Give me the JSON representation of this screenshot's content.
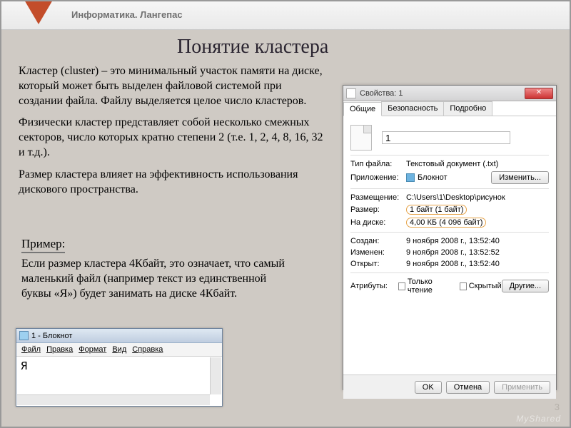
{
  "topbar": {
    "title": "Информатика. Лангепас"
  },
  "slide": {
    "title": "Понятие кластера",
    "p1": "Кластер (cluster) – это минимальный участок памяти на диске, который может быть выделен файловой системой при создании файла. Файлу выделяется целое число кластеров.",
    "p2": "Физически кластер представляет собой несколько смежных секторов, число которых кратно степени 2 (т.е. 1, 2, 4, 8, 16, 32 и т.д.).",
    "p3": "Размер кластера влияет на эффективность использования дискового пространства.",
    "example_label": "Пример:",
    "example_text": "Если размер кластера 4Кбайт, это означает, что самый маленький файл (например текст из единственной буквы «Я») будет занимать на диске 4Кбайт.",
    "number": "3"
  },
  "propwin": {
    "title": "Свойства: 1",
    "tabs": {
      "general": "Общие",
      "security": "Безопасность",
      "details": "Подробно"
    },
    "filename": "1",
    "rows": {
      "type_label": "Тип файла:",
      "type_value": "Текстовый документ (.txt)",
      "app_label": "Приложение:",
      "app_value": "Блокнот",
      "change_btn": "Изменить...",
      "location_label": "Размещение:",
      "location_value": "C:\\Users\\1\\Desktop\\рисунок",
      "size_label": "Размер:",
      "size_value": "1 байт (1 байт)",
      "ondisk_label": "На диске:",
      "ondisk_value": "4,00 КБ (4 096 байт)",
      "created_label": "Создан:",
      "created_value": "9 ноября 2008 г., 13:52:40",
      "modified_label": "Изменен:",
      "modified_value": "9 ноября 2008 г., 13:52:52",
      "opened_label": "Открыт:",
      "opened_value": "9 ноября 2008 г., 13:52:40",
      "attrs_label": "Атрибуты:",
      "readonly": "Только чтение",
      "hidden": "Скрытый",
      "other_btn": "Другие..."
    },
    "buttons": {
      "ok": "OK",
      "cancel": "Отмена",
      "apply": "Применить"
    }
  },
  "notepad": {
    "title": "1 - Блокнот",
    "menu": {
      "file": "Файл",
      "edit": "Правка",
      "format": "Формат",
      "view": "Вид",
      "help": "Справка"
    },
    "content": "Я"
  },
  "watermark": "MyShared"
}
